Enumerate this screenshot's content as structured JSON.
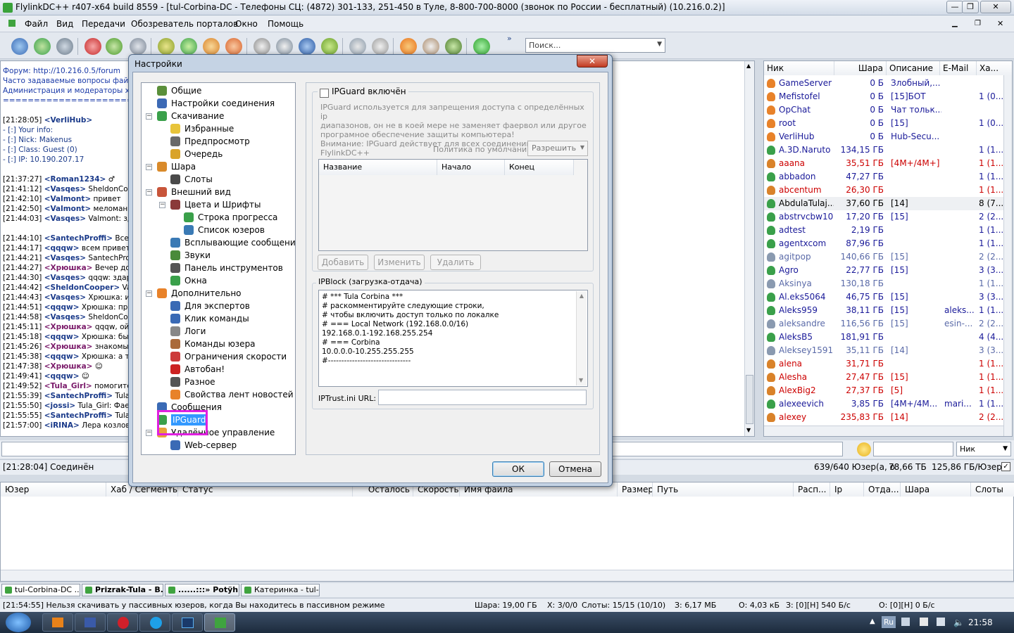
{
  "window": {
    "title": "FlylinkDC++ r407-x64 build 8559 - [tul-Corbina-DC - Телефоны СЦ: (4872) 301-133, 251-450 в Туле, 8-800-700-8000 (звонок по России - бесплатный) (10.216.0.2)]"
  },
  "menu": {
    "items": [
      "Файл",
      "Вид",
      "Передачи",
      "Обозреватель порталов",
      "Окно",
      "Помощь"
    ]
  },
  "toolbar": {
    "search_placeholder": "Поиск...",
    "more": "»"
  },
  "chat": {
    "lines": [
      {
        "t": "",
        "nick": "",
        "text": "Форум: http://10.216.0.5/forum"
      },
      {
        "t": "",
        "nick": "",
        "text": "Часто задаваемые вопросы файл"
      },
      {
        "t": "",
        "nick": "",
        "text": "Администрация и модераторы хаб"
      },
      {
        "t": "",
        "nick": "",
        "text": "==========================="
      },
      {
        "t": "",
        "nick": "",
        "text": ""
      },
      {
        "t": "[21:28:05] ",
        "nick": "<VerliHub>",
        "text": ""
      },
      {
        "t": "",
        "nick": "",
        "text": "- [:] Your info:"
      },
      {
        "t": "",
        "nick": "",
        "text": "- [:] Nick: Makenus"
      },
      {
        "t": "",
        "nick": "",
        "text": "- [:] Class: Guest (0)"
      },
      {
        "t": "",
        "nick": "",
        "text": "- [:] IP: 10.190.207.17"
      },
      {
        "t": "",
        "nick": "",
        "text": ""
      },
      {
        "t": "[21:37:27] ",
        "nick": "<Roman1234>",
        "text": " ♂"
      },
      {
        "t": "[21:41:12] ",
        "nick": "<Vasqes>",
        "text": " SheldonCoope"
      },
      {
        "t": "[21:42:10] ",
        "nick": "<Valmont>",
        "text": " привет"
      },
      {
        "t": "[21:42:50] ",
        "nick": "<Valmont>",
        "text": " меломаны е"
      },
      {
        "t": "[21:44:03] ",
        "nick": "<Vasqes>",
        "text": " Valmont: здар"
      },
      {
        "t": "",
        "nick": "",
        "text": ""
      },
      {
        "t": "[21:44:10] ",
        "nick": "<SantechProffi>",
        "text": " Всем п"
      },
      {
        "t": "[21:44:17] ",
        "nick": "<qqqw>",
        "text": " всем привет"
      },
      {
        "t": "[21:44:21] ",
        "nick": "<Vasqes>",
        "text": " SantechProffi"
      },
      {
        "t": "[21:44:27] ",
        "nick": "<Хрюшка>",
        "text": " Вечер добры"
      },
      {
        "t": "[21:44:30] ",
        "nick": "<Vasqes>",
        "text": " qqqw: здаров"
      },
      {
        "t": "[21:44:42] ",
        "nick": "<SheldonCooper>",
        "text": " Vaso"
      },
      {
        "t": "[21:44:43] ",
        "nick": "<Vasqes>",
        "text": " Хрюшка: и ва"
      },
      {
        "t": "[21:44:51] ",
        "nick": "<qqqw>",
        "text": " Хрюшка: приве"
      },
      {
        "t": "[21:44:58] ",
        "nick": "<Vasqes>",
        "text": " SheldonCooper"
      },
      {
        "t": "[21:45:11] ",
        "nick": "<Хрюшка>",
        "text": " qqqw, ой а"
      },
      {
        "t": "[21:45:18] ",
        "nick": "<qqqw>",
        "text": " Хрюшка: была"
      },
      {
        "t": "[21:45:26] ",
        "nick": "<Хрюшка>",
        "text": " знакомый ни"
      },
      {
        "t": "[21:45:38] ",
        "nick": "<qqqw>",
        "text": " Хрюшка: а тебя"
      },
      {
        "t": "[21:47:38] ",
        "nick": "<Хрюшка>",
        "text": " ☺"
      },
      {
        "t": "[21:49:41] ",
        "nick": "<qqqw>",
        "text": " ☺"
      },
      {
        "t": "[21:49:52] ",
        "nick": "<Tula_Girl>",
        "text": " помогитее!"
      },
      {
        "t": "[21:55:39] ",
        "nick": "<SantechProffi>",
        "text": " Tula_Gi"
      },
      {
        "t": "[21:55:50] ",
        "nick": "<jossi>",
        "text": " Tula_Girl: Фаерво"
      },
      {
        "t": "[21:55:55] ",
        "nick": "<SantechProffi>",
        "text": " Tula_Gi"
      },
      {
        "t": "[21:57:00] ",
        "nick": "<iRINA>",
        "text": " Лера козлова-не"
      }
    ]
  },
  "userlist": {
    "columns": [
      "Ник",
      "Шара",
      "Описание",
      "E-Mail",
      "Ха..."
    ],
    "rows": [
      {
        "nick": "GameServer",
        "share": "0 Б",
        "desc": "Злобный,...",
        "email": "",
        "hubs": "",
        "color": "#1a1a99"
      },
      {
        "nick": "Mefistofel",
        "share": "0 Б",
        "desc": "[15]БОТ",
        "email": "",
        "hubs": "1 (0...",
        "color": "#1a1a99"
      },
      {
        "nick": "OpChat",
        "share": "0 Б",
        "desc": "Чат тольк...",
        "email": "",
        "hubs": "",
        "color": "#1a1a99"
      },
      {
        "nick": "root",
        "share": "0 Б",
        "desc": "[15]",
        "email": "",
        "hubs": "1 (0...",
        "color": "#1a1a99"
      },
      {
        "nick": "VerliHub",
        "share": "0 Б",
        "desc": "Hub-Secu...",
        "email": "",
        "hubs": "",
        "color": "#1a1a99"
      },
      {
        "nick": "A.3D.Naruto",
        "share": "134,15 ГБ",
        "desc": "",
        "email": "",
        "hubs": "1 (1...",
        "color": "#1a1a99"
      },
      {
        "nick": "aaana",
        "share": "35,51 ГБ",
        "desc": "[4M+/4M+]",
        "email": "",
        "hubs": "1 (1...",
        "color": "#cc0000"
      },
      {
        "nick": "abbadon",
        "share": "47,27 ГБ",
        "desc": "",
        "email": "",
        "hubs": "1 (1...",
        "color": "#1a1a99"
      },
      {
        "nick": "abcentum",
        "share": "26,30 ГБ",
        "desc": "",
        "email": "",
        "hubs": "1 (1...",
        "color": "#cc0000"
      },
      {
        "nick": "AbdulaTulaj...",
        "share": "37,60 ГБ",
        "desc": "[14]",
        "email": "",
        "hubs": "8 (7...",
        "color": "#000000"
      },
      {
        "nick": "abstrvcbw10",
        "share": "17,20 ГБ",
        "desc": "[15]",
        "email": "",
        "hubs": "2 (2...",
        "color": "#1a1a99"
      },
      {
        "nick": "adtest",
        "share": "2,19 ГБ",
        "desc": "",
        "email": "",
        "hubs": "1 (1...",
        "color": "#1a1a99"
      },
      {
        "nick": "agentxcom",
        "share": "87,96 ГБ",
        "desc": "",
        "email": "",
        "hubs": "1 (1...",
        "color": "#1a1a99"
      },
      {
        "nick": "agitpop",
        "share": "140,66 ГБ",
        "desc": "[15]",
        "email": "",
        "hubs": "2 (2...",
        "color": "#5a6aa8"
      },
      {
        "nick": "Agro",
        "share": "22,77 ГБ",
        "desc": "[15]",
        "email": "",
        "hubs": "3 (3...",
        "color": "#1a1a99"
      },
      {
        "nick": "Aksinya",
        "share": "130,18 ГБ",
        "desc": "",
        "email": "",
        "hubs": "1 (1...",
        "color": "#5a6aa8"
      },
      {
        "nick": "Al.eks5064",
        "share": "46,75 ГБ",
        "desc": "[15]",
        "email": "",
        "hubs": "3 (3...",
        "color": "#1a1a99"
      },
      {
        "nick": "Aleks959",
        "share": "38,11 ГБ",
        "desc": "[15]",
        "email": "aleks...",
        "hubs": "1 (1...",
        "color": "#1a1a99"
      },
      {
        "nick": "aleksandre",
        "share": "116,56 ГБ",
        "desc": "[15]",
        "email": "esin-...",
        "hubs": "2 (2...",
        "color": "#5a6aa8"
      },
      {
        "nick": "AleksB5",
        "share": "181,91 ГБ",
        "desc": "",
        "email": "",
        "hubs": "4 (4...",
        "color": "#1a1a99"
      },
      {
        "nick": "Aleksey1591",
        "share": "35,11 ГБ",
        "desc": "[14]",
        "email": "",
        "hubs": "3 (3...",
        "color": "#5a6aa8"
      },
      {
        "nick": "alena",
        "share": "31,71 ГБ",
        "desc": "",
        "email": "",
        "hubs": "1 (1...",
        "color": "#cc0000"
      },
      {
        "nick": "Alesha",
        "share": "27,47 ГБ",
        "desc": "[15]",
        "email": "",
        "hubs": "1 (1...",
        "color": "#cc0000"
      },
      {
        "nick": "AlexBig2",
        "share": "27,37 ГБ",
        "desc": "[5]",
        "email": "",
        "hubs": "1 (1...",
        "color": "#cc0000"
      },
      {
        "nick": "alexeevich",
        "share": "3,85 ГБ",
        "desc": "[4M+/4M...",
        "email": "mari...",
        "hubs": "1 (1...",
        "color": "#1a1a99"
      },
      {
        "nick": "alexey",
        "share": "235,83 ГБ",
        "desc": "[14]",
        "email": "",
        "hubs": "2 (2...",
        "color": "#cc0000"
      }
    ]
  },
  "bottom": {
    "nick_select": "Ник",
    "status_left": "[21:28:04] Соединён",
    "status_users": "639/640 Юзер(а, о",
    "status_share": "78,66 ТБ",
    "status_per_user": "125,86 ГБ/Юзер"
  },
  "transfers": {
    "columns": [
      "Юзер",
      "Хаб / Сегменты",
      "Статус",
      "Осталось",
      "Скорость",
      "Имя файла",
      "Размер",
      "Путь",
      "Расп...",
      "Ip",
      "Отда...",
      "Шара",
      "Слоты"
    ]
  },
  "tabs": [
    "tul-Corbina-DC ...",
    "Prizrak-Tula - B...",
    "......:::» Potÿh ...",
    "Катеринка - tul-..."
  ],
  "statusbar": {
    "message": "[21:54:55] Нельзя скачивать у пассивных юзеров, когда Вы находитесь в пассивном режиме",
    "share": "Шара: 19,00 ГБ",
    "hubs": "Х: 3/0/0",
    "slots": "Слоты: 15/15 (10/10)",
    "down": "З: 6,17 МБ",
    "up": "О: 4,03 кБ",
    "dlrate": "З: [0][Н] 540 Б/с",
    "ulrate": "О: [0][Н] 0 Б/с"
  },
  "taskbar": {
    "lang": "Ru",
    "time": "21:58"
  },
  "dialog": {
    "title": "Настройки",
    "close": "✕",
    "tree": [
      {
        "label": "Общие",
        "indent": 0,
        "toggle": "",
        "color": "#5a8f3a"
      },
      {
        "label": "Настройки соединения",
        "indent": 0,
        "toggle": "",
        "color": "#3d6ab5"
      },
      {
        "label": "Скачивание",
        "indent": 0,
        "toggle": "−",
        "color": "#3aa04a"
      },
      {
        "label": "Избранные",
        "indent": 1,
        "toggle": "",
        "color": "#e8c43a"
      },
      {
        "label": "Предпросмотр",
        "indent": 1,
        "toggle": "",
        "color": "#6a6a6a"
      },
      {
        "label": "Очередь",
        "indent": 1,
        "toggle": "",
        "color": "#d9a32a"
      },
      {
        "label": "Шара",
        "indent": 0,
        "toggle": "−",
        "color": "#d98a2a"
      },
      {
        "label": "Слоты",
        "indent": 1,
        "toggle": "",
        "color": "#4a4a4a"
      },
      {
        "label": "Внешний вид",
        "indent": 0,
        "toggle": "−",
        "color": "#c8553a"
      },
      {
        "label": "Цвета и Шрифты",
        "indent": 1,
        "toggle": "−",
        "color": "#8a3a3a"
      },
      {
        "label": "Строка прогресса",
        "indent": 2,
        "toggle": "",
        "color": "#3aa04a"
      },
      {
        "label": "Список юзеров",
        "indent": 2,
        "toggle": "",
        "color": "#3a7ab5"
      },
      {
        "label": "Всплывающие сообщения",
        "indent": 1,
        "toggle": "",
        "color": "#3a7ab5"
      },
      {
        "label": "Звуки",
        "indent": 1,
        "toggle": "",
        "color": "#4a8a3a"
      },
      {
        "label": "Панель инструментов",
        "indent": 1,
        "toggle": "",
        "color": "#555555"
      },
      {
        "label": "Окна",
        "indent": 1,
        "toggle": "",
        "color": "#3aa04a"
      },
      {
        "label": "Дополнительно",
        "indent": 0,
        "toggle": "−",
        "color": "#e8822a"
      },
      {
        "label": "Для экспертов",
        "indent": 1,
        "toggle": "",
        "color": "#3a6ab5"
      },
      {
        "label": "Клик команды",
        "indent": 1,
        "toggle": "",
        "color": "#3a6ab5"
      },
      {
        "label": "Логи",
        "indent": 1,
        "toggle": "",
        "color": "#888888"
      },
      {
        "label": "Команды юзера",
        "indent": 1,
        "toggle": "",
        "color": "#aa6a3a"
      },
      {
        "label": "Ограничения скорости",
        "indent": 1,
        "toggle": "",
        "color": "#cc3a3a"
      },
      {
        "label": "Автобан!",
        "indent": 1,
        "toggle": "",
        "color": "#cc2222"
      },
      {
        "label": "Разное",
        "indent": 1,
        "toggle": "",
        "color": "#555555"
      },
      {
        "label": "Свойства лент новостей",
        "indent": 1,
        "toggle": "",
        "color": "#e8822a"
      },
      {
        "label": "Сообщения",
        "indent": 0,
        "toggle": "",
        "color": "#3a6ab5"
      },
      {
        "label": "IPGuard",
        "indent": 0,
        "toggle": "",
        "color": "#3aa04a",
        "selected": true
      },
      {
        "label": "Удалённое управление",
        "indent": 0,
        "toggle": "−",
        "color": "#e8a23a"
      },
      {
        "label": "Web-сервер",
        "indent": 1,
        "toggle": "",
        "color": "#3a6ab5"
      }
    ],
    "ipguard": {
      "checkbox": "IPGuard включён",
      "desc1": "IPGuard используется для запрещения доступа с определённых ip",
      "desc2": "диапазонов, он не в коей мере не заменяет фаервол или другое",
      "desc3": "програмное обеспечение защиты компьютера!",
      "desc4": "Внимание: IPGuard действует для всех соединений во FlylinkDC++",
      "policy_label": "Политика по умолчанию",
      "policy_value": "Разрешить",
      "col_name": "Название",
      "col_start": "Начало",
      "col_end": "Конец",
      "add": "Добавить",
      "edit": "Изменить",
      "del": "Удалить"
    },
    "ipblock": {
      "title": "IPBlock (загрузка-отдача)",
      "lines": [
        "# *** Tula Corbina ***",
        "# раскомментируйте следующие строки,",
        "# чтобы включить доступ только по локалке",
        "# === Local Network (192.168.0.0/16)",
        "192.168.0.1-192.168.255.254",
        "# === Corbina",
        "10.0.0.0-10.255.255.255",
        "#-------------------------------"
      ]
    },
    "iptrust_label": "IPTrust.ini URL:",
    "ok": "ОК",
    "cancel": "Отмена"
  }
}
